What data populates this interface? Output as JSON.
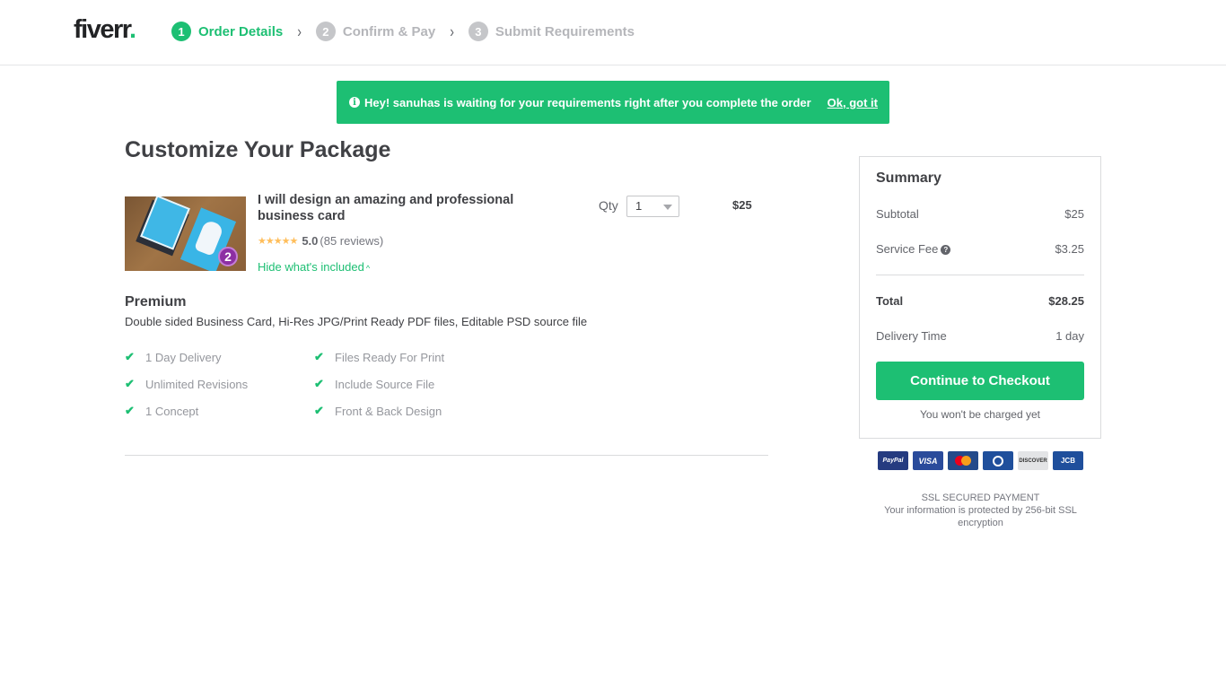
{
  "header": {
    "logo_text": "fiverr",
    "logo_dot": ".",
    "steps": [
      {
        "number": "1",
        "label": "Order Details",
        "state": "active"
      },
      {
        "number": "2",
        "label": "Confirm & Pay",
        "state": "inactive"
      },
      {
        "number": "3",
        "label": "Submit Requirements",
        "state": "inactive"
      }
    ],
    "separator": "›"
  },
  "banner": {
    "icon": "info-icon",
    "message": "Hey! sanuhas is waiting for your requirements right after you complete the order",
    "action_label": "Ok, got it"
  },
  "main": {
    "title": "Customize Your Package",
    "gig": {
      "title": "I will design an amazing and professional business card",
      "stars": "★★★★★",
      "rating": "5.0",
      "reviews": "(85 reviews)",
      "toggle_label": "Hide what's included",
      "toggle_icon": "^",
      "badge_level": "2",
      "qty_label": "Qty",
      "qty_value": "1",
      "price": "$25"
    },
    "package": {
      "name": "Premium",
      "description": "Double sided Business Card, Hi-Res JPG/Print Ready PDF files, Editable PSD source file",
      "features": [
        "1 Day Delivery",
        "Files Ready For Print",
        "Unlimited Revisions",
        "Include Source File",
        "1 Concept",
        "Front & Back Design"
      ],
      "check_icon": "✔"
    }
  },
  "summary": {
    "title": "Summary",
    "subtotal_label": "Subtotal",
    "subtotal_value": "$25",
    "service_fee_label": "Service Fee",
    "service_fee_value": "$3.25",
    "total_label": "Total",
    "total_value": "$28.25",
    "delivery_label": "Delivery Time",
    "delivery_value": "1 day",
    "checkout_label": "Continue to Checkout",
    "not_charged": "You won't be charged yet"
  },
  "payment": {
    "methods": [
      "PayPal",
      "VISA",
      "MasterCard",
      "Diners Club",
      "DISCOVER",
      "JCB"
    ],
    "ssl_title": "SSL SECURED PAYMENT",
    "ssl_text": "Your information is protected by 256-bit SSL encryption"
  },
  "colors": {
    "brand_green": "#1dbf73",
    "text_dark": "#404145",
    "text_muted": "#95979d",
    "star": "#ffbe5b"
  }
}
